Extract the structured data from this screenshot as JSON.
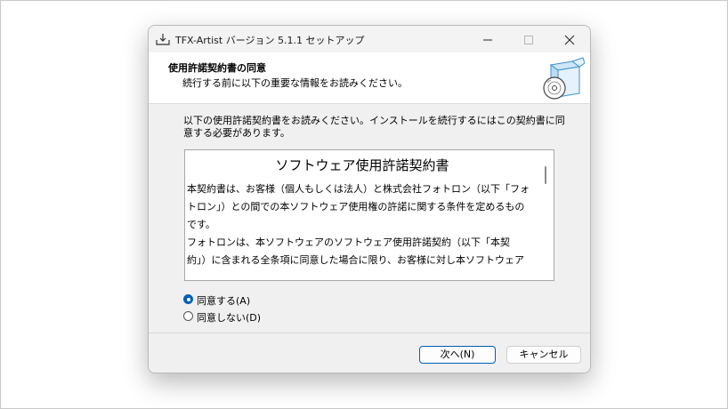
{
  "window": {
    "title": "TFX-Artist バージョン 5.1.1 セットアップ"
  },
  "header": {
    "title": "使用許諾契約書の同意",
    "subtitle": "続行する前に以下の重要な情報をお読みください。"
  },
  "instructions": "以下の使用許諾契約書をお読みください。インストールを続行するにはこの契約書に同意する必要があります。",
  "license": {
    "title": "ソフトウェア使用許諾契約書",
    "lines": [
      "本契約書は、お客様（個人もしくは法人）と株式会社フォトロン（以下「フォ",
      "トロン」）との間での本ソフトウェア使用権の許諾に関する条件を定めるもの",
      "です。",
      "フォトロンは、本ソフトウェアのソフトウェア使用許諾契約（以下「本契",
      "約」）に含まれる全条項に同意した場合に限り、お客様に対し本ソフトウェア"
    ]
  },
  "options": {
    "agree": "同意する(A)",
    "disagree": "同意しない(D)",
    "selected": "agree"
  },
  "buttons": {
    "next": "次へ(N)",
    "cancel": "キャンセル"
  },
  "colors": {
    "accent": "#005fb8",
    "dialog_bg": "#f0f0f0"
  }
}
